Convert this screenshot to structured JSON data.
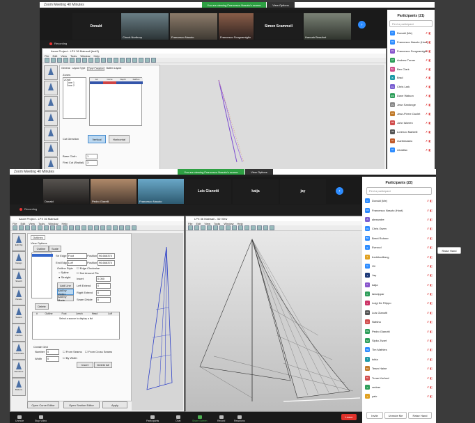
{
  "back_meeting": {
    "title": "Zoom Meeting 40 Minutes",
    "share_banner": "You are viewing Francesco Nasuto's screen",
    "view_options": "View Options",
    "recording": "Recording",
    "tiles": [
      "Donald",
      "Chuck Northrop",
      "Francesco Nasuto",
      "Francesco Scognamiglio",
      "Simon Scammell",
      "Hannah Beaufort"
    ],
    "sailplan_window": {
      "title": "Azure Project - LPX 36 Mainsail (test3)",
      "menu": [
        "File",
        "Edit",
        "View",
        "Tools",
        "Window",
        "Help"
      ],
      "tabs": [
        "General",
        "Layout Type",
        "Zone Creation",
        "Batten Layout"
      ],
      "zones_label": "Zones",
      "tree": [
        "ZONE",
        "Zone 1",
        "Zone 2"
      ],
      "columns": [
        "Alt",
        "Curve",
        "Depth",
        "RelPos"
      ],
      "cut_direction_label": "Cut Direction",
      "vertical": "Vertical",
      "horizontal": "Horizontal",
      "base_cloth_label": "Base Cloth",
      "first_cut_label": "First Cut (Radial)",
      "base_cloth_value": "1",
      "first_cut_value": "3"
    },
    "participants": {
      "title": "Participants (21)",
      "search_placeholder": "Find a participant",
      "list": [
        {
          "initials": "D",
          "name": "Donald (Me)",
          "color": "#2d8cff"
        },
        {
          "initials": "FN",
          "name": "Francesco Nasuto (Host)",
          "color": "#2d8cff"
        },
        {
          "initials": "FS",
          "name": "Francesco Scognamiglio",
          "color": "#8855cc"
        },
        {
          "initials": "AT",
          "name": "Andrew Turner",
          "color": "#2e9e5a"
        },
        {
          "initials": "BC",
          "name": "Ben Clark",
          "color": "#d14d8a"
        },
        {
          "initials": "B",
          "name": "Brad",
          "color": "#1f9aa8"
        },
        {
          "initials": "CL",
          "name": "Chris Lark",
          "color": "#7a5fd1"
        },
        {
          "initials": "DW",
          "name": "Dave Watson",
          "color": "#2e9e5a"
        },
        {
          "initials": "JS",
          "name": "Jean Santonge",
          "color": "#888888"
        },
        {
          "initials": "JO",
          "name": "Jean-Pierre Ouzlet",
          "color": "#c07a2a"
        },
        {
          "initials": "JW",
          "name": "John Warren",
          "color": "#d14d4d"
        },
        {
          "initials": "LM",
          "name": "Lorenzo Markelli",
          "color": "#555555"
        },
        {
          "initials": "M",
          "name": "martinbalaro",
          "color": "#c05a2a"
        },
        {
          "initials": "M",
          "name": "mhalifax",
          "color": "#2d8cff"
        }
      ]
    }
  },
  "front_meeting": {
    "title": "Zoom Meeting 40 Minutes",
    "share_banner": "You are viewing Francesco Nasuto's screen",
    "view_options": "View Options",
    "recording": "Recording",
    "tiles": [
      "Donald",
      "Pedro Giarelli",
      "Francesco Nasuto",
      "Luis Gianotti",
      "katja",
      "jay"
    ],
    "azure_window": {
      "title": "Azure Project - LPX 36 Mainsail",
      "menu": [
        "File",
        "Edit",
        "View",
        "Tools",
        "Window",
        "Help"
      ],
      "side_tools": [
        "Edit Rig",
        "Design",
        "Stretch",
        "Panels",
        "Seams",
        "Patches",
        "Cut Details",
        "Reinforce",
        "Battens"
      ],
      "tab": "Outlines",
      "view_options": "View Options",
      "outline_btn": "Outline",
      "scale_btn": "Scale",
      "start_edge_label": "Str Edge",
      "start_edge_value": "Foot",
      "end_edge_label": "End Edge",
      "end_edge_value": "Luff",
      "position_label": "Position",
      "position_1": "96.666374",
      "position_2": "96.666374",
      "outline_style_label": "Outline Style",
      "spline": "Spline",
      "straight": "Straight",
      "edge_clockwise": "Edge Clockwise",
      "not_around_pts": "Not Around Pts",
      "insert_label": "Insert",
      "insert_value": "0.050",
      "left_extend_label": "Left Extend",
      "left_extend_value": "0",
      "right_extend_label": "Right Extend",
      "right_extend_value": "0",
      "seam_divide_label": "Seam Divide",
      "seam_divide_value": "0",
      "add_line": "Add Line",
      "add_by_vertex": "Add by Vertex",
      "add_by_mode": "Add by Mode",
      "delete": "Delete",
      "table_headers": [
        "#",
        "Outline",
        "Foot",
        "Leech",
        "Head",
        "Luff"
      ],
      "table_note": "Select a source to display a list",
      "create_grid": "Create Grid",
      "number_label": "Number",
      "number_value": "0",
      "width_label": "Width",
      "width_value": "0",
      "from_seams": "From Seams",
      "from_cross_seams": "From Cross Seams",
      "by_width": "By Width",
      "insert_btn": "Insert",
      "delete_all": "Delete All",
      "open_curve_editor": "Open Curve Editor",
      "open_section_editor": "Open Section Editor",
      "apply": "Apply"
    },
    "view3d_window": {
      "title": "LPX 36 Mainsail - 3D View"
    },
    "participants": {
      "title": "Participants (22)",
      "search_placeholder": "Find a participant",
      "list": [
        {
          "initials": "D",
          "name": "Donald (Me)",
          "color": "#2d8cff"
        },
        {
          "initials": "FN",
          "name": "Francesco Nasuto (Host)",
          "color": "#2d8cff"
        },
        {
          "initials": "A",
          "name": "alexandre",
          "color": "#7a5fd1"
        },
        {
          "initials": "CG",
          "name": "Chris Gwen",
          "color": "#2d8cff"
        },
        {
          "initials": "BR",
          "name": "Brent Rohner",
          "color": "#2d8cff"
        },
        {
          "initials": "E",
          "name": "Ewroud",
          "color": "#2d8cff"
        },
        {
          "initials": "F",
          "name": "fredrikodlberg",
          "color": "#e0a020"
        },
        {
          "initials": "G",
          "name": "Gil",
          "color": "#2d8cff"
        },
        {
          "initials": "J",
          "name": "Jay",
          "color": "#1e3a78"
        },
        {
          "initials": "K",
          "name": "katja",
          "color": "#8855cc"
        },
        {
          "initials": "K",
          "name": "larsnippar",
          "color": "#2e9e5a"
        },
        {
          "initials": "L",
          "name": "Luigi De Filippo",
          "color": "#cc3366"
        },
        {
          "initials": "LG",
          "name": "Luis Gianotti",
          "color": "#555555"
        },
        {
          "initials": "N",
          "name": "Natsha",
          "color": "#d14d4d"
        },
        {
          "initials": "PG",
          "name": "Pedro Gianotti",
          "color": "#2e9e5a"
        },
        {
          "initials": "SZ",
          "name": "Sipko Zwart",
          "color": "#2e9e5a"
        },
        {
          "initials": "TM",
          "name": "Tim Mathies",
          "color": "#2d8cff"
        },
        {
          "initials": "T",
          "name": "tobia",
          "color": "#1f9aa8"
        },
        {
          "initials": "TH",
          "name": "Team Haine",
          "color": "#c07a2a"
        },
        {
          "initials": "TK",
          "name": "Turan Kerford",
          "color": "#d14d4d"
        },
        {
          "initials": "V",
          "name": "vedran",
          "color": "#2e9e5a"
        },
        {
          "initials": "Y",
          "name": "yalo",
          "color": "#e0a020"
        }
      ],
      "invite": "Invite",
      "unmute_me": "Unmute Me",
      "raise_hand": "Raise Hand"
    },
    "controls": {
      "unmute": "Unmute",
      "stop_video": "Stop Video",
      "participants": "Participants",
      "participants_count": "22",
      "chat": "Chat",
      "share_screen": "Share Screen",
      "record": "Record",
      "reactions": "Reactions",
      "leave": "Leave"
    },
    "raise_hand_back": "Raise Hand"
  }
}
